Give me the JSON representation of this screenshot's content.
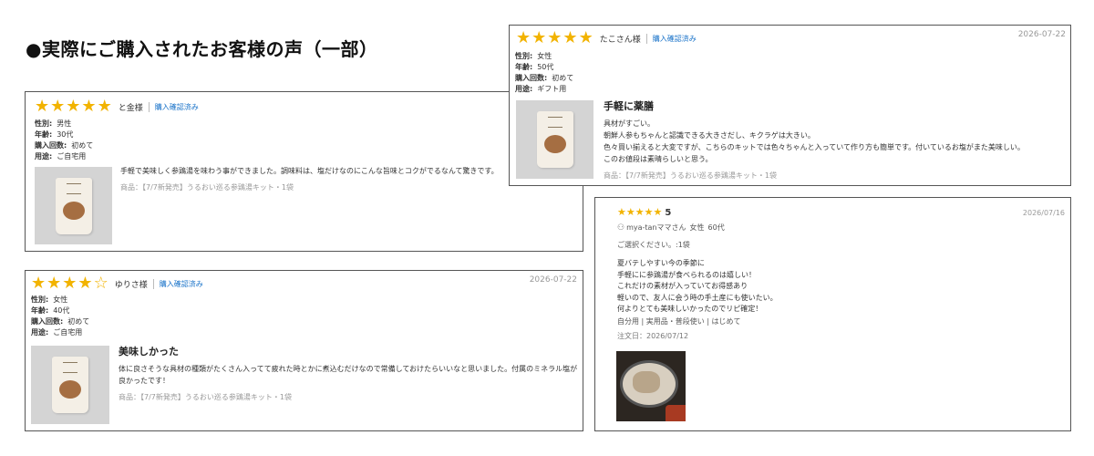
{
  "page_title": "●実際にご購入されたお客様の声（一部）",
  "colors": {
    "star": "#f2b300",
    "verified": "#1a73c9",
    "border": "#555555"
  },
  "reviews": [
    {
      "stars": 5,
      "name": "と金様",
      "verified": "購入確認済み",
      "date": "",
      "attrs": [
        {
          "k": "性別:",
          "v": "男性"
        },
        {
          "k": "年齢:",
          "v": "30代"
        },
        {
          "k": "購入回数:",
          "v": "初めて"
        },
        {
          "k": "用途:",
          "v": "ご自宅用"
        }
      ],
      "title": "",
      "text": "手軽で美味しく参鶏湯を味わう事ができました。調味料は、塩だけなのにこんな旨味とコクがでるなんて驚きです。",
      "product": "商品：【7/7新発売】うるおい巡る参鶏湯キット・1袋"
    },
    {
      "stars": 5,
      "name": "たこさん様",
      "verified": "購入確認済み",
      "date": "2026-07-22",
      "attrs": [
        {
          "k": "性別:",
          "v": "女性"
        },
        {
          "k": "年齢:",
          "v": "50代"
        },
        {
          "k": "購入回数:",
          "v": "初めて"
        },
        {
          "k": "用途:",
          "v": "ギフト用"
        }
      ],
      "title": "手軽に薬膳",
      "text": "具材がすごい。\n朝鮮人参もちゃんと認識できる大きさだし、キクラゲは大きい。\n色々買い揃えると大変ですが、こちらのキットでは色々ちゃんと入っていて作り方も簡単です。付いているお塩がまた美味しい。\nこのお値段は素晴らしいと思う。",
      "product": "商品：【7/7新発売】うるおい巡る参鶏湯キット・1袋"
    },
    {
      "stars": 4,
      "name": "ゆりさ様",
      "verified": "購入確認済み",
      "date": "2026-07-22",
      "attrs": [
        {
          "k": "性別:",
          "v": "女性"
        },
        {
          "k": "年齢:",
          "v": "40代"
        },
        {
          "k": "購入回数:",
          "v": "初めて"
        },
        {
          "k": "用途:",
          "v": "ご自宅用"
        }
      ],
      "title": "美味しかった",
      "text": "体に良さそうな具材の種類がたくさん入ってて疲れた時とかに煮込むだけなので常備しておけたらいいなと思いました。付属のミネラル塩が\n良かったです！",
      "product": "商品：【7/7新発売】うるおい巡る参鶏湯キット・1袋"
    }
  ],
  "review4": {
    "stars": 5,
    "score": "5",
    "date": "2026/07/16",
    "user": "mya-tanママさん",
    "gender": "女性",
    "age": "60代",
    "selection": "ご選択ください。:1袋",
    "text": "夏バテしやすい今の季節に\n手軽にに参鶏湯が食べられるのは嬉しい！\nこれだけの素材が入っていてお得感あり\n軽いので、友人に会う時の手土産にも使いたい。\n何よりとても美味しいかったのでリピ確定！",
    "tags": "自分用 | 実用品・普段使い | はじめて",
    "order_date": "注文日：2026/07/12"
  }
}
